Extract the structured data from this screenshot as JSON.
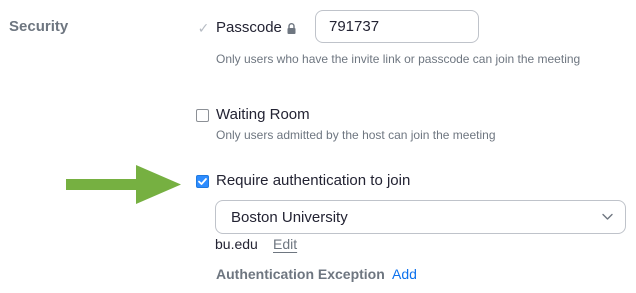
{
  "security": {
    "section_label": "Security",
    "passcode": {
      "label": "Passcode",
      "value": "791737",
      "helper": "Only users who have the invite link or passcode can join the meeting",
      "checked": true,
      "disabled": true
    },
    "waiting_room": {
      "label": "Waiting Room",
      "helper": "Only users admitted by the host can join the meeting",
      "checked": false
    },
    "require_auth": {
      "label": "Require authentication to join",
      "checked": true,
      "selected_option": "Boston University",
      "domain": "bu.edu",
      "edit_label": "Edit"
    },
    "auth_exception": {
      "label": "Authentication Exception",
      "add_label": "Add"
    }
  },
  "colors": {
    "accent_blue": "#2d8cff",
    "link_blue": "#0e72ed",
    "arrow_green": "#76b041",
    "muted_text": "#6e7680"
  },
  "icons": {
    "lock": "lock-icon",
    "chevron": "chevron-down-icon",
    "arrow": "arrow-right-icon"
  }
}
